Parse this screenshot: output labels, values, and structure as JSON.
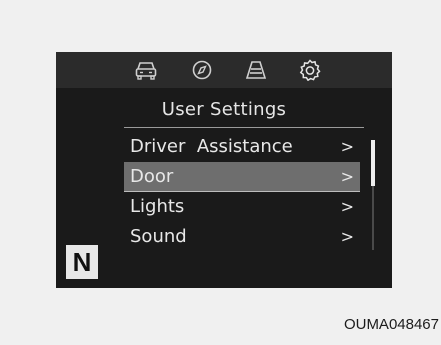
{
  "tabs": [
    {
      "icon": "car-icon"
    },
    {
      "icon": "compass-icon"
    },
    {
      "icon": "lane-road-icon"
    },
    {
      "icon": "gear-icon",
      "active": true
    }
  ],
  "screen": {
    "title": "User Settings",
    "menu": [
      {
        "label": "Driver  Assistance",
        "chevron": ">",
        "selected": false
      },
      {
        "label": "Door",
        "chevron": ">",
        "selected": true
      },
      {
        "label": "Lights",
        "chevron": ">",
        "selected": false
      },
      {
        "label": "Sound",
        "chevron": ">",
        "selected": false
      }
    ],
    "gear_indicator": "N"
  },
  "caption": "OUMA048467"
}
